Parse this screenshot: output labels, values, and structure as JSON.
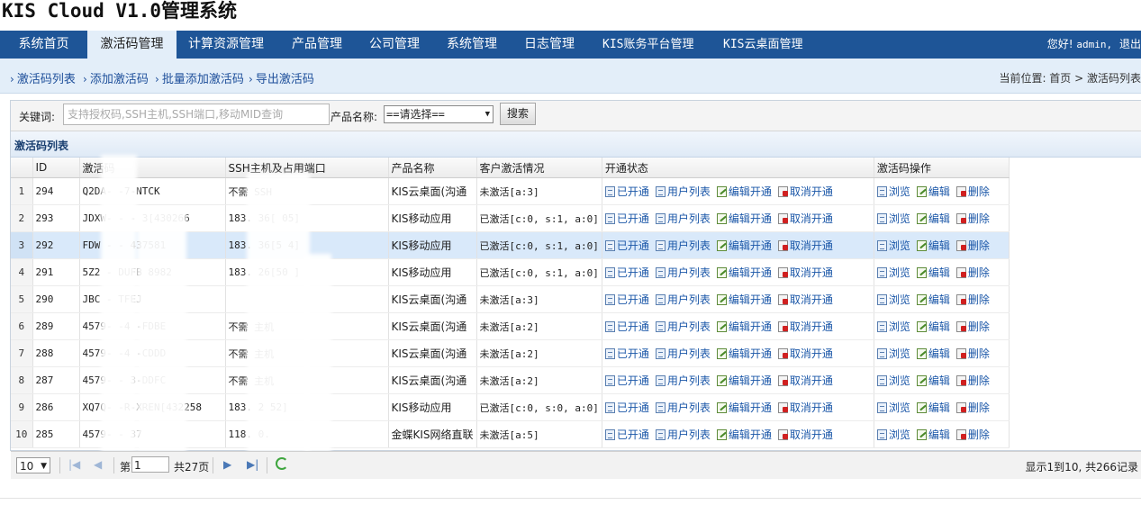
{
  "app": {
    "title": "KIS Cloud V1.0管理系统"
  },
  "topnav": {
    "items": [
      {
        "label": "系统首页",
        "active": false
      },
      {
        "label": "激活码管理",
        "active": true
      },
      {
        "label": "计算资源管理",
        "active": false
      },
      {
        "label": "产品管理",
        "active": false
      },
      {
        "label": "公司管理",
        "active": false
      },
      {
        "label": "系统管理",
        "active": false
      },
      {
        "label": "日志管理",
        "active": false
      },
      {
        "label": "KIS账务平台管理",
        "active": false
      },
      {
        "label": "KIS云桌面管理",
        "active": false
      }
    ],
    "greeting": "您好!",
    "username": "admin,",
    "logout": "退出"
  },
  "subnav": {
    "links": [
      "激活码列表",
      "添加激活码",
      "批量添加激活码",
      "导出激活码"
    ],
    "breadcrumb": "当前位置: 首页 > 激活码列表"
  },
  "search": {
    "keyword_label": "关键词:",
    "keyword_placeholder": "支持授权码,SSH主机,SSH端口,移动MID查询",
    "product_label": "产品名称:",
    "product_value": "==请选择==",
    "button": "搜索"
  },
  "list": {
    "title": "激活码列表",
    "columns": [
      "ID",
      "激活码",
      "SSH主机及占用端口",
      "产品名称",
      "客户激活情况",
      "开通状态",
      "激活码操作"
    ],
    "actions_open": [
      "已开通",
      "用户列表",
      "编辑开通",
      "取消开通"
    ],
    "actions_code": [
      "浏览",
      "编辑",
      "删除"
    ],
    "rows": [
      {
        "n": "1",
        "id": "294",
        "code": "Q2DA-      -7-NTCK",
        "ssh": "不需     SSH    ",
        "product": "KIS云桌面(沟通",
        "status": "未激活[a:3]",
        "red": false
      },
      {
        "n": "2",
        "id": "293",
        "code": "JDXW-     -  -   3[430266",
        "ssh": "183.       36[    05]",
        "product": "KIS移动应用",
        "status": "已激活[c:0, s:1, a:0]",
        "red": true
      },
      {
        "n": "3",
        "id": "292",
        "code": "FDW     -    -  437581",
        "ssh": "183.        36[5   4]",
        "product": "KIS移动应用",
        "status": "已激活[c:0, s:1, a:0]",
        "red": true
      },
      {
        "n": "4",
        "id": "291",
        "code": "5Z2     -    DUFB 8982",
        "ssh": "183.        26[50   ]",
        "product": "KIS移动应用",
        "status": "已激活[c:0, s:1, a:0]",
        "red": true
      },
      {
        "n": "5",
        "id": "290",
        "code": "JBC      -   TFEJ",
        "ssh": "",
        "product": "KIS云桌面(沟通",
        "status": "未激活[a:3]",
        "red": false
      },
      {
        "n": "6",
        "id": "289",
        "code": "4579-     -4  -FDBE",
        "ssh": "不需       主机",
        "product": "KIS云桌面(沟通",
        "status": "未激活[a:2]",
        "red": false
      },
      {
        "n": "7",
        "id": "288",
        "code": "4579-     -4  -CDDD",
        "ssh": "不需       主机",
        "product": "KIS云桌面(沟通",
        "status": "未激活[a:2]",
        "red": false
      },
      {
        "n": "8",
        "id": "287",
        "code": "4579-     -  3-DDFC",
        "ssh": "不需       主机",
        "product": "KIS云桌面(沟通",
        "status": "未激活[a:2]",
        "red": false
      },
      {
        "n": "9",
        "id": "286",
        "code": "XQ7Q-     -R-XREN[432258",
        "ssh": "183.      2     52]",
        "product": "KIS移动应用",
        "status": "已激活[c:0, s:0, a:0]",
        "red": true
      },
      {
        "n": "10",
        "id": "285",
        "code": "4579-      -   37",
        "ssh": "118.      0.    ",
        "product": "金蝶KIS网络直联",
        "status": "未激活[a:5]",
        "red": false
      }
    ]
  },
  "pager": {
    "page_size": "10",
    "page_prefix": "第",
    "current_page": "1",
    "total_pages": "共27页",
    "info": "显示1到10, 共266记录"
  }
}
